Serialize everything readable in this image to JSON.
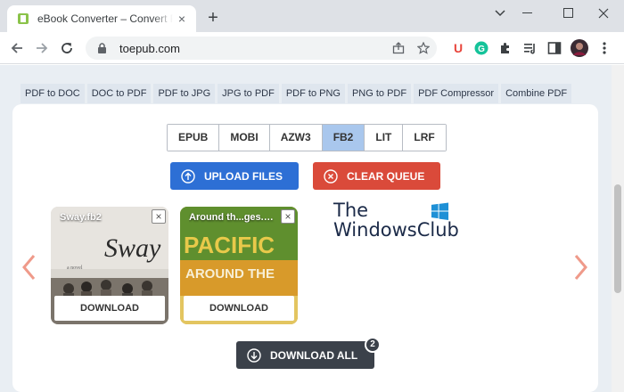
{
  "browser": {
    "tab_title": "eBook Converter – Convert PDF & Word to EPUB",
    "tab_close": "×",
    "new_tab": "+",
    "url": "toepub.com",
    "extensions": [
      {
        "name": "u-extension-icon",
        "label": "U",
        "color": "#e8453c"
      },
      {
        "name": "grammarly-icon",
        "label": "G",
        "color": "#15c39a"
      }
    ]
  },
  "tools_nav": [
    "PDF to DOC",
    "DOC to PDF",
    "PDF to JPG",
    "JPG to PDF",
    "PDF to PNG",
    "PNG to PDF",
    "PDF Compressor",
    "Combine PDF"
  ],
  "formats": {
    "options": [
      "EPUB",
      "MOBI",
      "AZW3",
      "FB2",
      "LIT",
      "LRF"
    ],
    "selected": "FB2"
  },
  "actions": {
    "upload_label": "UPLOAD FILES",
    "clear_label": "CLEAR QUEUE"
  },
  "files": [
    {
      "name": "Sway.fb2",
      "cover_text": "Sway",
      "cover_caption": "a novel",
      "download_label": "DOWNLOAD",
      "close": "×"
    },
    {
      "name": "Around th...ges.fb2",
      "cover_text": "PACIFIC",
      "cover_caption": "AROUND THE",
      "download_label": "DOWNLOAD",
      "close": "×"
    }
  ],
  "watermark": {
    "line1": "The",
    "line2": "WindowsClub"
  },
  "download_all": {
    "label": "DOWNLOAD ALL",
    "count": "2"
  },
  "colors": {
    "accent_blue": "#2d6fd5",
    "accent_red": "#da4a3a",
    "selected_format": "#a9c7ed",
    "dark_button": "#3b414a",
    "arrow": "#ef9a8a"
  }
}
